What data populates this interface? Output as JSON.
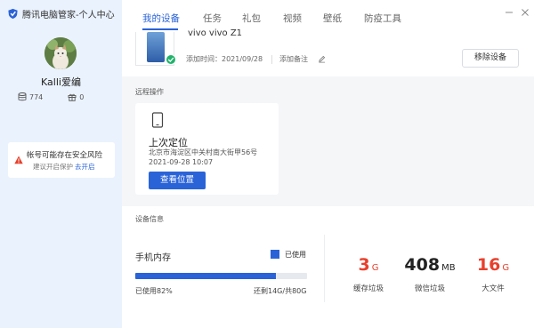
{
  "app": {
    "title": "腾讯电脑管家-个人中心"
  },
  "user": {
    "name": "Kalli爱编",
    "stat_storage": "774",
    "stat_gift": "0"
  },
  "warning": {
    "line1": "帐号可能存在安全风险",
    "line2": "建议开启保护",
    "link": "去开启"
  },
  "nav": {
    "tabs": [
      "我的设备",
      "任务",
      "礼包",
      "视频",
      "壁纸",
      "防疫工具"
    ],
    "active": 0
  },
  "device": {
    "name": "vivo vivo Z1",
    "added_time": "添加时间：2021/09/28",
    "note": "添加备注",
    "remove_button": "移除设备"
  },
  "remote": {
    "section_label": "远程操作",
    "title": "上次定位",
    "address": "北京市海淀区中关村南大街甲56号",
    "time": "2021-09-28 10:07",
    "view_button": "查看位置"
  },
  "device_info": {
    "section_label": "设备信息",
    "memory_label": "手机内存",
    "legend_used": "已使用",
    "used_percent_text": "已使用82%",
    "used_fraction": 0.82,
    "remaining_text": "还剩14G/共80G",
    "metrics": [
      {
        "value": "3",
        "unit": "G",
        "label": "缓存垃圾",
        "color": "#e8402c"
      },
      {
        "value": "408",
        "unit": "MB",
        "label": "微信垃圾",
        "color": "#222222"
      },
      {
        "value": "16",
        "unit": "G",
        "label": "大文件",
        "color": "#e8402c"
      }
    ]
  },
  "colors": {
    "accent": "#2a63d8",
    "warning": "#e8402c",
    "check": "#21b36b"
  }
}
